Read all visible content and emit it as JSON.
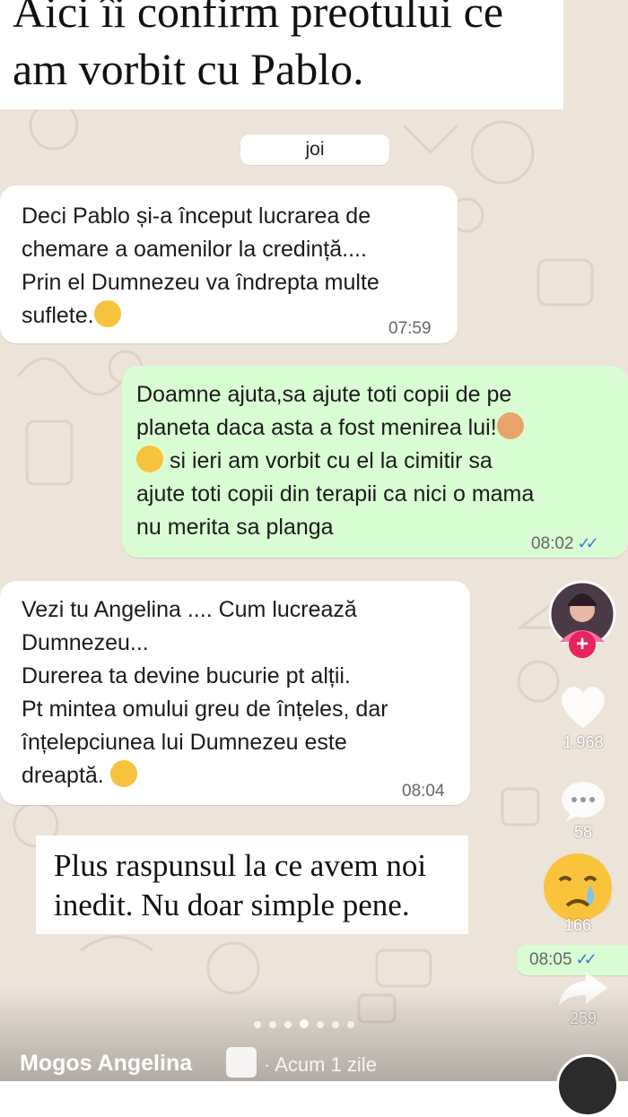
{
  "story": {
    "top_caption": [
      "Aici îi confirm preotului ce",
      "am vorbit cu Pablo."
    ],
    "bottom_caption": [
      "Plus raspunsul la ce avem noi",
      "inedit. Nu doar simple pene."
    ]
  },
  "chat": {
    "date_label": "joi",
    "messages": [
      {
        "direction": "incoming",
        "lines": [
          "Deci Pablo și-a început lucrarea de",
          "chemare a oamenilor la credință....",
          "Prin el Dumnezeu va îndrepta multe",
          "suflete."
        ],
        "emoji": "hugging-face",
        "time": "07:59"
      },
      {
        "direction": "outgoing",
        "lines": [
          "Doamne ajuta,sa ajute toti copii de pe",
          "planeta daca asta a fost menirea lui!",
          " si ieri am vorbit cu el la cimitir sa",
          "ajute toti copii din terapii ca nici o mama",
          "nu merita sa planga"
        ],
        "emoji": [
          "folded-hands",
          "pleading-face"
        ],
        "time": "08:02",
        "status": "read"
      },
      {
        "direction": "incoming",
        "lines": [
          "Vezi tu Angelina .... Cum lucrează",
          "Dumnezeu...",
          "Durerea ta devine bucurie pt alții.",
          "Pt mintea omului greu de înțeles, dar",
          "înțelepciunea lui Dumnezeu este",
          "dreaptă."
        ],
        "emoji": "hugging-face",
        "time": "08:04"
      },
      {
        "direction": "outgoing",
        "lines": [],
        "time": "08:05",
        "status": "read"
      }
    ]
  },
  "sidebar": {
    "likes": "1.968",
    "comments": "58",
    "reaction_count": "166",
    "shares": "259"
  },
  "footer": {
    "username": "Mogos Angelina",
    "time_ago": "· Acum 1 zile",
    "pages_total": 7,
    "page_active": 4
  },
  "colors": {
    "chat_bg": "#ece3d9",
    "incoming_bubble": "#ffffff",
    "outgoing_bubble": "#d9fdd3",
    "read_ticks": "#3a7bd5",
    "follow_badge": "#e8245c"
  }
}
